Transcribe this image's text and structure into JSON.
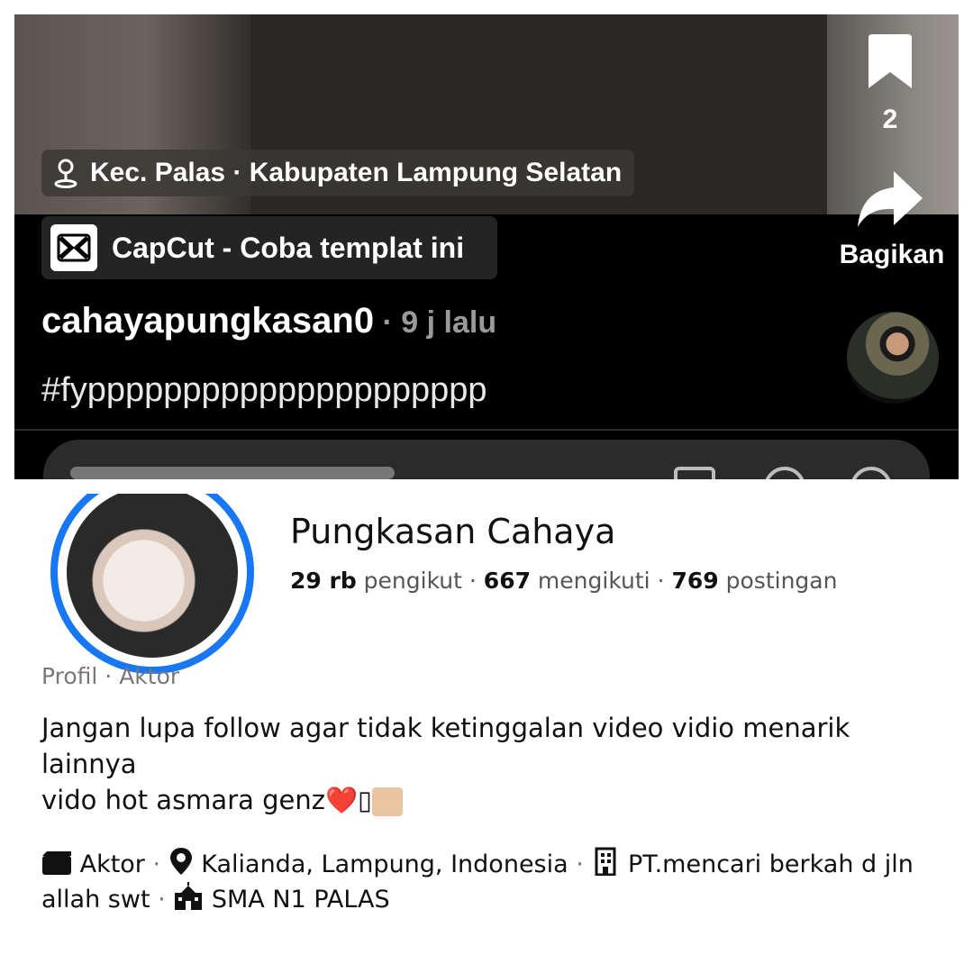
{
  "video": {
    "location_label": "Kec. Palas · Kabupaten Lampung Selatan",
    "capcut_label": "CapCut - Coba templat ini",
    "username": "cahayapungkasan0",
    "time_ago": " · 9 j lalu",
    "caption": "#fyppppppppppppppppppppp",
    "bookmark_count": "2",
    "share_label": "Bagikan"
  },
  "profile": {
    "name": "Pungkasan Cahaya",
    "followers_count": "29 rb",
    "followers_label": " pengikut",
    "following_count": "667",
    "following_label": " mengikuti",
    "posts_count": "769",
    "posts_label": " postingan",
    "category": "Profil · Aktor",
    "bio_line1": "Jangan lupa follow agar tidak ketinggalan video vidio menarik lainnya",
    "bio_line2": "vido hot asmara genz",
    "bio_heart": "❤️",
    "bio_box": "▯",
    "detail_job": "Aktor",
    "detail_location": "Kalianda, Lampung, Indonesia",
    "detail_work": "PT.mencari berkah d jln allah swt",
    "detail_school": "SMA N1 PALAS",
    "detail_separator": " · "
  },
  "colors": {
    "brand_blue": "#1877f2",
    "heart_red": "#e0245e"
  },
  "icons": [
    "location-pin-icon",
    "capcut-icon",
    "bookmark-icon",
    "share-icon",
    "clapper-icon",
    "map-pin-icon",
    "building-icon",
    "school-icon"
  ]
}
